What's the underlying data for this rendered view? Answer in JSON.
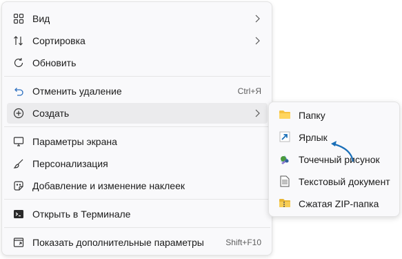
{
  "context_menu": {
    "items": [
      {
        "label": "Вид",
        "icon": "grid-view-icon",
        "has_submenu": true
      },
      {
        "label": "Сортировка",
        "icon": "sort-icon",
        "has_submenu": true
      },
      {
        "label": "Обновить",
        "icon": "refresh-icon"
      },
      {
        "label": "Отменить удаление",
        "icon": "undo-icon",
        "shortcut": "Ctrl+Я"
      },
      {
        "label": "Создать",
        "icon": "plus-circle-icon",
        "has_submenu": true,
        "highlighted": true
      },
      {
        "label": "Параметры экрана",
        "icon": "display-icon"
      },
      {
        "label": "Персонализация",
        "icon": "brush-icon"
      },
      {
        "label": "Добавление и изменение наклеек",
        "icon": "sticker-icon"
      },
      {
        "label": "Открыть в Терминале",
        "icon": "terminal-icon"
      },
      {
        "label": "Показать дополнительные параметры",
        "icon": "more-options-icon",
        "shortcut": "Shift+F10"
      }
    ]
  },
  "create_submenu": {
    "items": [
      {
        "label": "Папку",
        "icon": "folder-icon"
      },
      {
        "label": "Ярлык",
        "icon": "shortcut-icon"
      },
      {
        "label": "Точечный рисунок",
        "icon": "bitmap-icon"
      },
      {
        "label": "Текстовый документ",
        "icon": "text-document-icon"
      },
      {
        "label": "Сжатая ZIP-папка",
        "icon": "zip-folder-icon"
      }
    ]
  },
  "colors": {
    "accent": "#1a6fb8",
    "highlight": "#ebebed",
    "menu_bg": "#f9f9fb"
  }
}
